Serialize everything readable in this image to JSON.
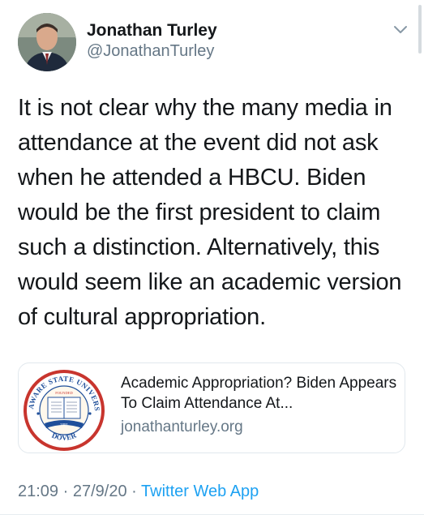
{
  "author": {
    "display_name": "Jonathan Turley",
    "handle": "@JonathanTurley"
  },
  "tweet": {
    "text": "It is not clear why the many media in attendance at the event did not ask when he attended a HBCU. Biden would be the first president to claim such a distinction. Alternatively, this would seem like an academic version of cultural appropriation."
  },
  "link_card": {
    "title": "Academic Appropriation? Biden Appears To Claim Attendance At...",
    "domain": "jonathanturley.org",
    "seal": {
      "top_text": "DELAWARE STATE UNIVERSITY",
      "bottom_text": "DOVER",
      "founded_label": "FOUNDED",
      "year": "1891"
    }
  },
  "meta": {
    "time": "21:09",
    "separator": "·",
    "date": "27/9/20",
    "source": "Twitter Web App"
  },
  "icons": {
    "menu": "chevron-down-icon",
    "avatar": "avatar"
  },
  "colors": {
    "text": "#14171a",
    "secondary": "#657786",
    "link": "#1da1f2",
    "border": "#e1e8ed",
    "seal_red": "#c8352e",
    "seal_blue": "#1f4f9a"
  }
}
